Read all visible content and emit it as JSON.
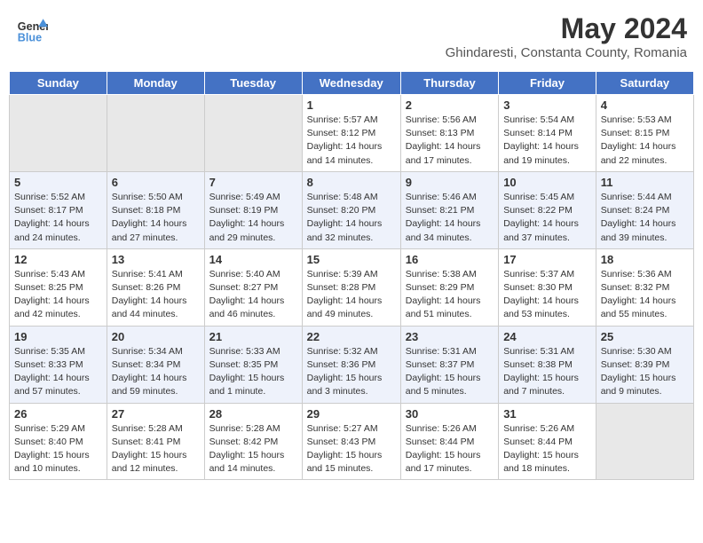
{
  "header": {
    "logo_line1": "General",
    "logo_line2": "Blue",
    "title": "May 2024",
    "subtitle": "Ghindaresti, Constanta County, Romania"
  },
  "weekdays": [
    "Sunday",
    "Monday",
    "Tuesday",
    "Wednesday",
    "Thursday",
    "Friday",
    "Saturday"
  ],
  "weeks": [
    [
      {
        "day": "",
        "info": ""
      },
      {
        "day": "",
        "info": ""
      },
      {
        "day": "",
        "info": ""
      },
      {
        "day": "1",
        "info": "Sunrise: 5:57 AM\nSunset: 8:12 PM\nDaylight: 14 hours and 14 minutes."
      },
      {
        "day": "2",
        "info": "Sunrise: 5:56 AM\nSunset: 8:13 PM\nDaylight: 14 hours and 17 minutes."
      },
      {
        "day": "3",
        "info": "Sunrise: 5:54 AM\nSunset: 8:14 PM\nDaylight: 14 hours and 19 minutes."
      },
      {
        "day": "4",
        "info": "Sunrise: 5:53 AM\nSunset: 8:15 PM\nDaylight: 14 hours and 22 minutes."
      }
    ],
    [
      {
        "day": "5",
        "info": "Sunrise: 5:52 AM\nSunset: 8:17 PM\nDaylight: 14 hours and 24 minutes."
      },
      {
        "day": "6",
        "info": "Sunrise: 5:50 AM\nSunset: 8:18 PM\nDaylight: 14 hours and 27 minutes."
      },
      {
        "day": "7",
        "info": "Sunrise: 5:49 AM\nSunset: 8:19 PM\nDaylight: 14 hours and 29 minutes."
      },
      {
        "day": "8",
        "info": "Sunrise: 5:48 AM\nSunset: 8:20 PM\nDaylight: 14 hours and 32 minutes."
      },
      {
        "day": "9",
        "info": "Sunrise: 5:46 AM\nSunset: 8:21 PM\nDaylight: 14 hours and 34 minutes."
      },
      {
        "day": "10",
        "info": "Sunrise: 5:45 AM\nSunset: 8:22 PM\nDaylight: 14 hours and 37 minutes."
      },
      {
        "day": "11",
        "info": "Sunrise: 5:44 AM\nSunset: 8:24 PM\nDaylight: 14 hours and 39 minutes."
      }
    ],
    [
      {
        "day": "12",
        "info": "Sunrise: 5:43 AM\nSunset: 8:25 PM\nDaylight: 14 hours and 42 minutes."
      },
      {
        "day": "13",
        "info": "Sunrise: 5:41 AM\nSunset: 8:26 PM\nDaylight: 14 hours and 44 minutes."
      },
      {
        "day": "14",
        "info": "Sunrise: 5:40 AM\nSunset: 8:27 PM\nDaylight: 14 hours and 46 minutes."
      },
      {
        "day": "15",
        "info": "Sunrise: 5:39 AM\nSunset: 8:28 PM\nDaylight: 14 hours and 49 minutes."
      },
      {
        "day": "16",
        "info": "Sunrise: 5:38 AM\nSunset: 8:29 PM\nDaylight: 14 hours and 51 minutes."
      },
      {
        "day": "17",
        "info": "Sunrise: 5:37 AM\nSunset: 8:30 PM\nDaylight: 14 hours and 53 minutes."
      },
      {
        "day": "18",
        "info": "Sunrise: 5:36 AM\nSunset: 8:32 PM\nDaylight: 14 hours and 55 minutes."
      }
    ],
    [
      {
        "day": "19",
        "info": "Sunrise: 5:35 AM\nSunset: 8:33 PM\nDaylight: 14 hours and 57 minutes."
      },
      {
        "day": "20",
        "info": "Sunrise: 5:34 AM\nSunset: 8:34 PM\nDaylight: 14 hours and 59 minutes."
      },
      {
        "day": "21",
        "info": "Sunrise: 5:33 AM\nSunset: 8:35 PM\nDaylight: 15 hours and 1 minute."
      },
      {
        "day": "22",
        "info": "Sunrise: 5:32 AM\nSunset: 8:36 PM\nDaylight: 15 hours and 3 minutes."
      },
      {
        "day": "23",
        "info": "Sunrise: 5:31 AM\nSunset: 8:37 PM\nDaylight: 15 hours and 5 minutes."
      },
      {
        "day": "24",
        "info": "Sunrise: 5:31 AM\nSunset: 8:38 PM\nDaylight: 15 hours and 7 minutes."
      },
      {
        "day": "25",
        "info": "Sunrise: 5:30 AM\nSunset: 8:39 PM\nDaylight: 15 hours and 9 minutes."
      }
    ],
    [
      {
        "day": "26",
        "info": "Sunrise: 5:29 AM\nSunset: 8:40 PM\nDaylight: 15 hours and 10 minutes."
      },
      {
        "day": "27",
        "info": "Sunrise: 5:28 AM\nSunset: 8:41 PM\nDaylight: 15 hours and 12 minutes."
      },
      {
        "day": "28",
        "info": "Sunrise: 5:28 AM\nSunset: 8:42 PM\nDaylight: 15 hours and 14 minutes."
      },
      {
        "day": "29",
        "info": "Sunrise: 5:27 AM\nSunset: 8:43 PM\nDaylight: 15 hours and 15 minutes."
      },
      {
        "day": "30",
        "info": "Sunrise: 5:26 AM\nSunset: 8:44 PM\nDaylight: 15 hours and 17 minutes."
      },
      {
        "day": "31",
        "info": "Sunrise: 5:26 AM\nSunset: 8:44 PM\nDaylight: 15 hours and 18 minutes."
      },
      {
        "day": "",
        "info": ""
      }
    ]
  ]
}
